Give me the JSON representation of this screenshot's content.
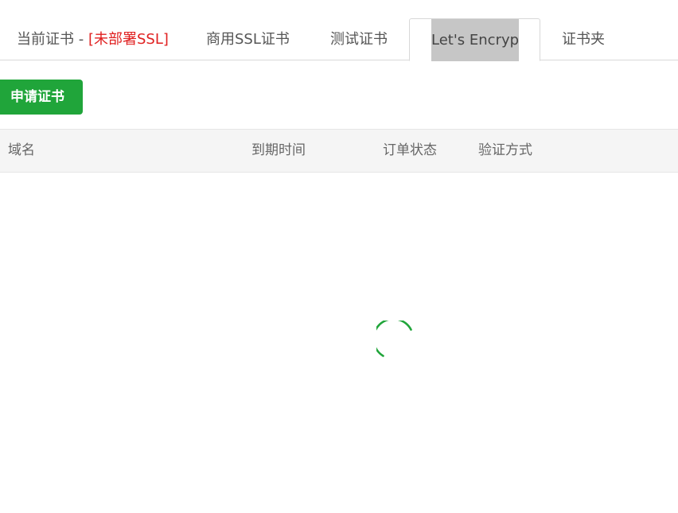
{
  "tabs": {
    "current": {
      "label": "当前证书 - ",
      "warning": "[未部署SSL]"
    },
    "commercial": {
      "label": "商用SSL证书"
    },
    "test": {
      "label": "测试证书"
    },
    "letsencrypt": {
      "label": "Let's Encrypt"
    },
    "folder": {
      "label": "证书夹"
    }
  },
  "toolbar": {
    "apply_label": "申请证书"
  },
  "table": {
    "columns": [
      "域名",
      "到期时间",
      "订单状态",
      "验证方式"
    ],
    "rows": []
  },
  "colors": {
    "accent": "#20a53a",
    "warning": "#e02020",
    "tab_selection_highlight": "#c6c6c6"
  },
  "loading": {
    "icon": "spinner-icon"
  }
}
